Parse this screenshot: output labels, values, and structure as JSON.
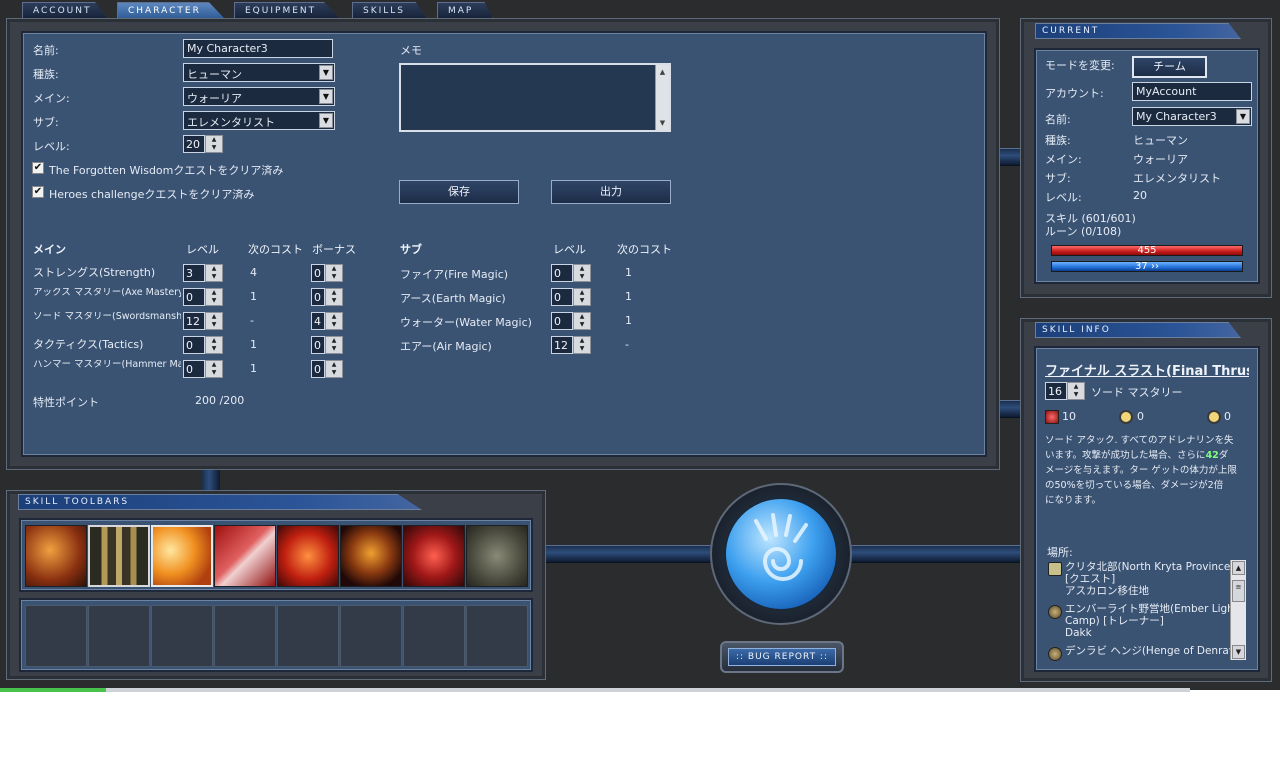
{
  "tabs": [
    {
      "label": "ACCOUNT"
    },
    {
      "label": "CHARACTER"
    },
    {
      "label": "EQUIPMENT"
    },
    {
      "label": "SKILLS"
    },
    {
      "label": "MAP"
    }
  ],
  "character": {
    "name_label": "名前:",
    "name_value": "My Character3",
    "race_label": "種族:",
    "race_value": "ヒューマン",
    "main_label": "メイン:",
    "main_value": "ウォーリア",
    "sub_label": "サブ:",
    "sub_value": "エレメンタリスト",
    "level_label": "レベル:",
    "level_value": "20",
    "quest1_label": "The Forgotten Wisdomクエストをクリア済み",
    "quest1_checked": "✔",
    "quest2_label": "Heroes challengeクエストをクリア済み",
    "quest2_checked": "✔",
    "memo_label": "メモ",
    "save_button": "保存",
    "export_button": "出力"
  },
  "attributes": {
    "main_header": "メイン",
    "sub_header": "サブ",
    "level_header": "レベル",
    "cost_header": "次のコスト",
    "bonus_header": "ボーナス",
    "main_rows": [
      {
        "name": "ストレングス(Strength)",
        "level": "3",
        "cost": "4",
        "bonus": "0"
      },
      {
        "name": "アックス マスタリー(Axe Mastery)",
        "level": "0",
        "cost": "1",
        "bonus": "0"
      },
      {
        "name": "ソード マスタリー(Swordsmanship)",
        "level": "12",
        "cost": "-",
        "bonus": "4"
      },
      {
        "name": "タクティクス(Tactics)",
        "level": "0",
        "cost": "1",
        "bonus": "0"
      },
      {
        "name": "ハンマー マスタリー(Hammer Mastery)",
        "level": "0",
        "cost": "1",
        "bonus": "0"
      }
    ],
    "sub_rows": [
      {
        "name": "ファイア(Fire Magic)",
        "level": "0",
        "cost": "1"
      },
      {
        "name": "アース(Earth Magic)",
        "level": "0",
        "cost": "1"
      },
      {
        "name": "ウォーター(Water Magic)",
        "level": "0",
        "cost": "1"
      },
      {
        "name": "エアー(Air Magic)",
        "level": "12",
        "cost": "-"
      }
    ],
    "points_label": "特性ポイント",
    "points_value": "200 /200"
  },
  "toolbars": {
    "title": "SKILL TOOLBARS",
    "skills": [
      {
        "icon": "warrior-strike-icon"
      },
      {
        "icon": "pillars-icon"
      },
      {
        "icon": "sword-thrust-icon"
      },
      {
        "icon": "red-slash-icon"
      },
      {
        "icon": "flame-fist-icon"
      },
      {
        "icon": "rage-face-icon"
      },
      {
        "icon": "lightning-sword-icon"
      },
      {
        "icon": "signet-icon"
      }
    ]
  },
  "current": {
    "title": "CURRENT",
    "mode_label": "モードを変更:",
    "mode_button": "チーム",
    "account_label": "アカウント:",
    "account_value": "MyAccount",
    "name_label": "名前:",
    "name_value": "My Character3",
    "race_label": "種族:",
    "race_value": "ヒューマン",
    "main_label": "メイン:",
    "main_value": "ウォーリア",
    "sub_label": "サブ:",
    "sub_value": "エレメンタリスト",
    "level_label": "レベル:",
    "level_value": "20",
    "skills_text": "スキル (601/601)",
    "runes_text": "ルーン (0/108)",
    "health_value": "455",
    "energy_value": "37",
    "energy_regen": "››"
  },
  "skill_info": {
    "title": "SKILL INFO",
    "skill_name": "ファイナル スラスト(Final Thrust",
    "attr_level": "16",
    "attr_name": "ソード マスタリー",
    "adrenaline": "10",
    "activation": "0",
    "recharge": "0",
    "desc_line1": "ソード アタック. すべてのアドレナリンを失",
    "desc_line2a": "います。攻撃が成功した場合、さらに",
    "desc_highlight": "42",
    "desc_line2b": "ダ",
    "desc_line3": "メージを与えます。ター ゲットの体力が上限",
    "desc_line4": "の50%を切っている場合、ダメージが2倍",
    "desc_line5": "になります。",
    "location_label": "場所:",
    "locations": [
      {
        "line1": "クリタ北部(North Kryta Province)",
        "line2": "[クエスト]",
        "line3": "アスカロン移住地"
      },
      {
        "line1": "エンバーライト野営地(Ember Light",
        "line2": "Camp) [トレーナー]",
        "line3": "Dakk"
      },
      {
        "line1": "デンラビ ヘンジ(Henge of Denravi",
        "line2": "",
        "line3": ""
      }
    ]
  },
  "bug_report": ":: BUG REPORT ::",
  "colors": {
    "accent": "#2e5b95",
    "panel": "#3b5372",
    "highlight": "#7dff7d"
  }
}
